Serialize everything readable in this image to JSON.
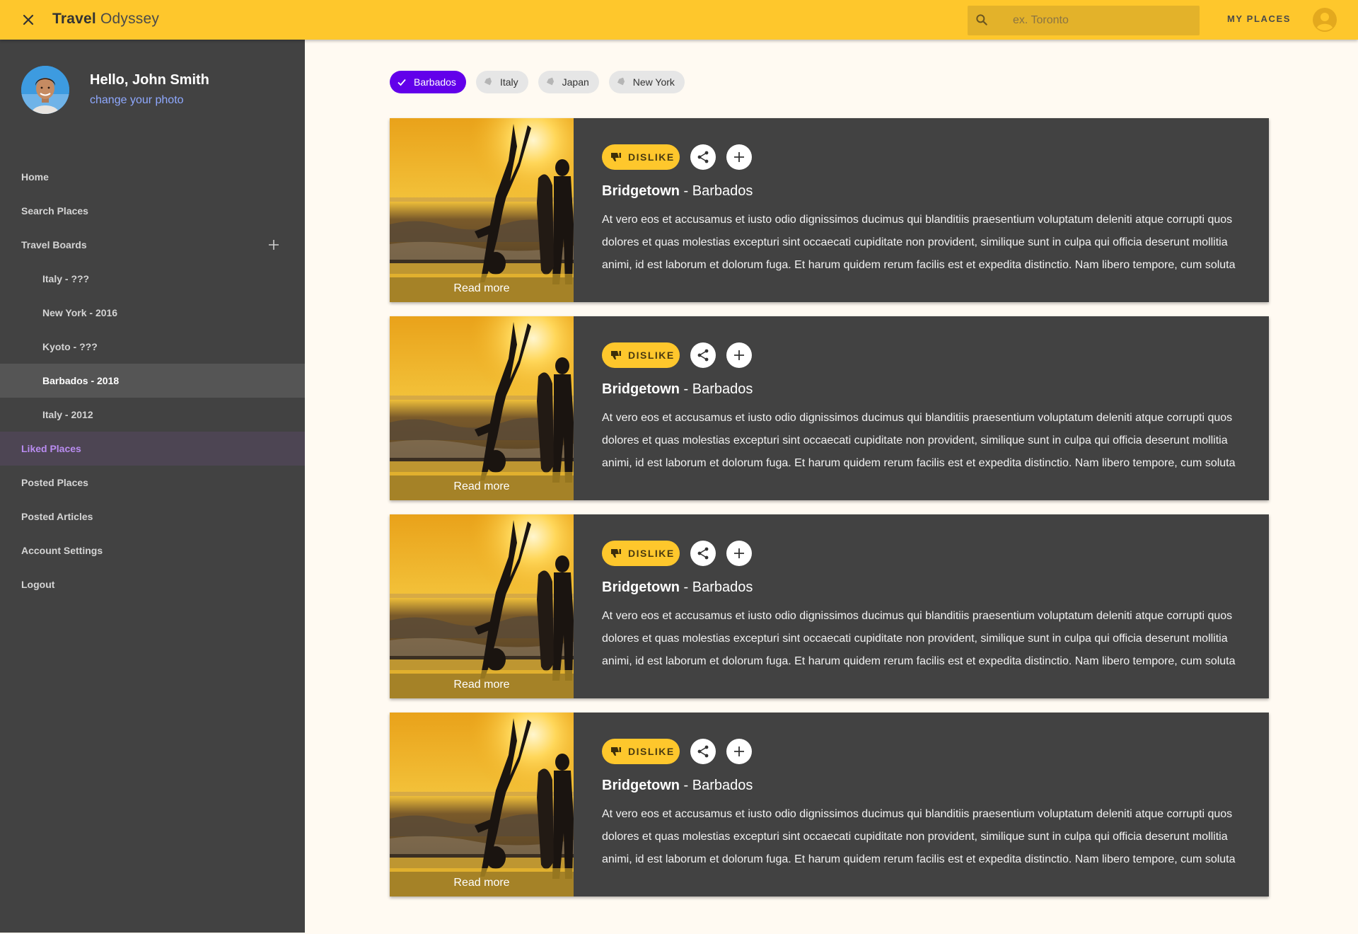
{
  "app": {
    "title_bold": "Travel",
    "title_light": "Odyssey"
  },
  "header": {
    "search_placeholder": "ex. Toronto",
    "my_places_label": "MY PLACES"
  },
  "profile": {
    "greeting": "Hello, John Smith",
    "change_photo": "change your photo"
  },
  "sidebar": {
    "items": [
      {
        "label": "Home"
      },
      {
        "label": "Search Places"
      },
      {
        "label": "Travel Boards"
      },
      {
        "label": "Italy - ???"
      },
      {
        "label": "New York - 2016"
      },
      {
        "label": "Kyoto - ???"
      },
      {
        "label": "Barbados - 2018"
      },
      {
        "label": "Italy - 2012"
      },
      {
        "label": "Liked Places"
      },
      {
        "label": "Posted Places"
      },
      {
        "label": "Posted Articles"
      },
      {
        "label": "Account Settings"
      },
      {
        "label": "Logout"
      }
    ]
  },
  "filters": [
    {
      "label": "Barbados",
      "selected": true
    },
    {
      "label": "Italy",
      "selected": false
    },
    {
      "label": "Japan",
      "selected": false
    },
    {
      "label": "New York",
      "selected": false
    }
  ],
  "cards": [
    {
      "read_more": "Read more",
      "dislike_label": "DISLIKE",
      "city": "Bridgetown",
      "country": " - Barbados",
      "description": "At vero eos et accusamus et iusto odio dignissimos ducimus qui blanditiis praesentium voluptatum deleniti atque corrupti quos dolores et quas molestias excepturi sint occaecati cupiditate non provident, similique sunt in culpa qui officia deserunt mollitia animi, id est laborum et dolorum fuga. Et harum quidem rerum facilis est et expedita distinctio. Nam libero tempore, cum soluta"
    },
    {
      "read_more": "Read more",
      "dislike_label": "DISLIKE",
      "city": "Bridgetown",
      "country": " - Barbados",
      "description": "At vero eos et accusamus et iusto odio dignissimos ducimus qui blanditiis praesentium voluptatum deleniti atque corrupti quos dolores et quas molestias excepturi sint occaecati cupiditate non provident, similique sunt in culpa qui officia deserunt mollitia animi, id est laborum et dolorum fuga. Et harum quidem rerum facilis est et expedita distinctio. Nam libero tempore, cum soluta"
    },
    {
      "read_more": "Read more",
      "dislike_label": "DISLIKE",
      "city": "Bridgetown",
      "country": " - Barbados",
      "description": "At vero eos et accusamus et iusto odio dignissimos ducimus qui blanditiis praesentium voluptatum deleniti atque corrupti quos dolores et quas molestias excepturi sint occaecati cupiditate non provident, similique sunt in culpa qui officia deserunt mollitia animi, id est laborum et dolorum fuga. Et harum quidem rerum facilis est et expedita distinctio. Nam libero tempore, cum soluta"
    },
    {
      "read_more": "Read more",
      "dislike_label": "DISLIKE",
      "city": "Bridgetown",
      "country": " - Barbados",
      "description": "At vero eos et accusamus et iusto odio dignissimos ducimus qui blanditiis praesentium voluptatum deleniti atque corrupti quos dolores et quas molestias excepturi sint occaecati cupiditate non provident, similique sunt in culpa qui officia deserunt mollitia animi, id est laborum et dolorum fuga. Et harum quidem rerum facilis est et expedita distinctio. Nam libero tempore, cum soluta"
    }
  ],
  "icons": {
    "close": "close-icon",
    "search": "search-icon",
    "account": "account-circle-icon",
    "add": "plus-icon",
    "check": "check-icon",
    "tag": "tag-icon",
    "thumb_down": "thumb-down-icon",
    "share": "share-icon"
  },
  "colors": {
    "topbar": "#fec72c",
    "sidebar": "#424242",
    "accent_purple": "#6200ea",
    "liked_text": "#b98cf0",
    "card": "#424242",
    "page_bg": "#fffaf2"
  }
}
